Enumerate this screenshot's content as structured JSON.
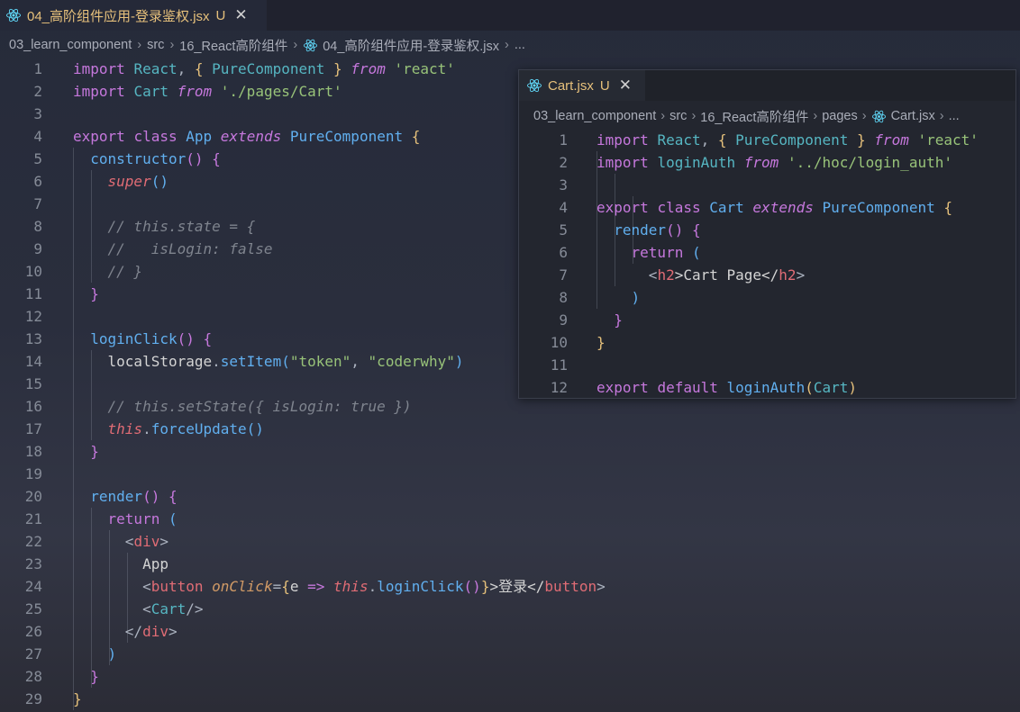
{
  "main_tab": {
    "title": "04_高阶组件应用-登录鉴权.jsx",
    "status": "U"
  },
  "breadcrumb": {
    "items": [
      "03_learn_component",
      "src",
      "16_React高阶组件",
      "04_高阶组件应用-登录鉴权.jsx",
      "..."
    ]
  },
  "main_code": {
    "line_numbers": [
      "1",
      "2",
      "3",
      "4",
      "5",
      "6",
      "7",
      "8",
      "9",
      "10",
      "11",
      "12",
      "13",
      "14",
      "15",
      "16",
      "17",
      "18",
      "19",
      "20",
      "21",
      "22",
      "23",
      "24",
      "25",
      "26",
      "27",
      "28",
      "29"
    ],
    "tokens": {
      "l1": [
        "import",
        "React",
        ", ",
        "{",
        " PureComponent ",
        "}",
        "from",
        "'react'"
      ],
      "l2": [
        "import",
        "Cart",
        "from",
        "'./pages/Cart'"
      ],
      "l4": [
        "export",
        "class",
        "App",
        "extends",
        "PureComponent",
        "{"
      ],
      "l5": [
        "constructor",
        "()",
        " {"
      ],
      "l6": [
        "super",
        "()"
      ],
      "l7": [
        "// this.state = {"
      ],
      "l8": [
        "//   isLogin: false"
      ],
      "l9": [
        "// }"
      ],
      "l10": [
        "}"
      ],
      "l12": [
        "loginClick",
        "()",
        " {"
      ],
      "l13": [
        "localStorage",
        ".",
        "setItem",
        "(",
        "\"token\"",
        ", ",
        "\"coderwhy\"",
        ")"
      ],
      "l15": [
        "// this.setState({ isLogin: true })"
      ],
      "l16": [
        "this",
        ".",
        "forceUpdate",
        "()"
      ],
      "l17": [
        "}"
      ],
      "l19": [
        "render",
        "()",
        " {"
      ],
      "l20": [
        "return",
        " ("
      ],
      "l21": [
        "<",
        "div",
        ">"
      ],
      "l22": [
        "App"
      ],
      "l23": [
        "<",
        "button",
        "onClick",
        "=",
        "{",
        "e",
        "=>",
        "this",
        ".",
        "loginClick",
        "()",
        "}",
        ">登录</",
        "button",
        ">"
      ],
      "l24": [
        "<",
        "Cart",
        "/>"
      ],
      "l25": [
        "</",
        "div",
        ">"
      ],
      "l26": [
        ")"
      ],
      "l27": [
        "}"
      ],
      "l28": [
        "}"
      ]
    }
  },
  "peek": {
    "tab": {
      "title": "Cart.jsx",
      "status": "U"
    },
    "breadcrumb": {
      "items": [
        "03_learn_component",
        "src",
        "16_React高阶组件",
        "pages",
        "Cart.jsx",
        "..."
      ]
    },
    "line_numbers": [
      "1",
      "2",
      "3",
      "4",
      "5",
      "6",
      "7",
      "8",
      "9",
      "10",
      "11",
      "12"
    ],
    "tokens": {
      "p1": [
        "import",
        "React",
        ", ",
        "{",
        " PureComponent ",
        "}",
        "from",
        "'react'"
      ],
      "p2": [
        "import",
        "loginAuth",
        "from",
        "'../hoc/login_auth'"
      ],
      "p4": [
        "export",
        "class",
        "Cart",
        "extends",
        "PureComponent",
        "{"
      ],
      "p5": [
        "render",
        "()",
        " {"
      ],
      "p6": [
        "return",
        " ("
      ],
      "p7": [
        "<",
        "h2",
        ">Cart Page</",
        "h2",
        ">"
      ],
      "p8": [
        ")"
      ],
      "p9": [
        "}"
      ],
      "p10": [
        "}"
      ],
      "p12": [
        "export",
        "default",
        "loginAuth",
        "(",
        "Cart",
        ")"
      ]
    }
  },
  "colors": {
    "keyword": "#c678dd",
    "string": "#98c379",
    "function": "#61afef",
    "comment": "#7f848e",
    "tag": "#e06c75",
    "tab_title": "#e6c07b"
  },
  "icons": [
    "react-file-icon",
    "close-icon",
    "chevron-right-icon"
  ]
}
